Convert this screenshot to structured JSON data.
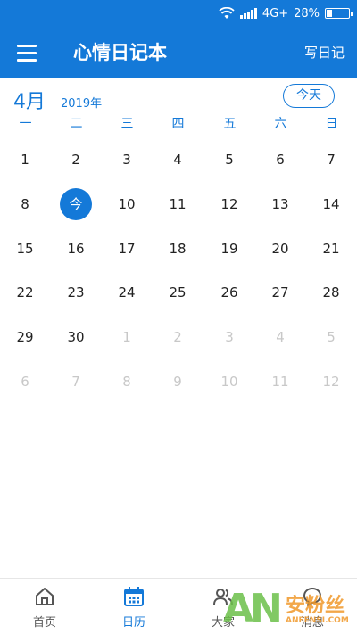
{
  "status_bar": {
    "network": "4G+",
    "battery_text": "28%",
    "battery_level": 0.28
  },
  "app_bar": {
    "title": "心情日记本",
    "write_label": "写日记"
  },
  "calendar": {
    "month": "4月",
    "year": "2019年",
    "today_label": "今天",
    "weekdays": [
      "一",
      "二",
      "三",
      "四",
      "五",
      "六",
      "日"
    ],
    "today_marker": "今",
    "weeks": [
      [
        {
          "d": "1"
        },
        {
          "d": "2"
        },
        {
          "d": "3"
        },
        {
          "d": "4"
        },
        {
          "d": "5"
        },
        {
          "d": "6"
        },
        {
          "d": "7"
        }
      ],
      [
        {
          "d": "8"
        },
        {
          "d": "今",
          "today": true
        },
        {
          "d": "10"
        },
        {
          "d": "11"
        },
        {
          "d": "12"
        },
        {
          "d": "13"
        },
        {
          "d": "14"
        }
      ],
      [
        {
          "d": "15"
        },
        {
          "d": "16"
        },
        {
          "d": "17"
        },
        {
          "d": "18"
        },
        {
          "d": "19"
        },
        {
          "d": "20"
        },
        {
          "d": "21"
        }
      ],
      [
        {
          "d": "22"
        },
        {
          "d": "23"
        },
        {
          "d": "24"
        },
        {
          "d": "25"
        },
        {
          "d": "26"
        },
        {
          "d": "27"
        },
        {
          "d": "28"
        }
      ],
      [
        {
          "d": "29"
        },
        {
          "d": "30"
        },
        {
          "d": "1",
          "other": true
        },
        {
          "d": "2",
          "other": true
        },
        {
          "d": "3",
          "other": true
        },
        {
          "d": "4",
          "other": true
        },
        {
          "d": "5",
          "other": true
        }
      ],
      [
        {
          "d": "6",
          "other": true
        },
        {
          "d": "7",
          "other": true
        },
        {
          "d": "8",
          "other": true
        },
        {
          "d": "9",
          "other": true
        },
        {
          "d": "10",
          "other": true
        },
        {
          "d": "11",
          "other": true
        },
        {
          "d": "12",
          "other": true
        }
      ]
    ]
  },
  "bottom_nav": {
    "items": [
      {
        "label": "首页",
        "icon": "home-icon"
      },
      {
        "label": "日历",
        "icon": "calendar-icon",
        "active": true
      },
      {
        "label": "大家",
        "icon": "people-icon"
      },
      {
        "label": "消息",
        "icon": "message-icon"
      }
    ]
  },
  "watermark": {
    "logo": "AN",
    "cn": "安粉丝",
    "en": "ANFENSI.COM"
  },
  "colors": {
    "primary": "#1479d8",
    "text": "#222222",
    "muted": "#c8c8c8"
  }
}
